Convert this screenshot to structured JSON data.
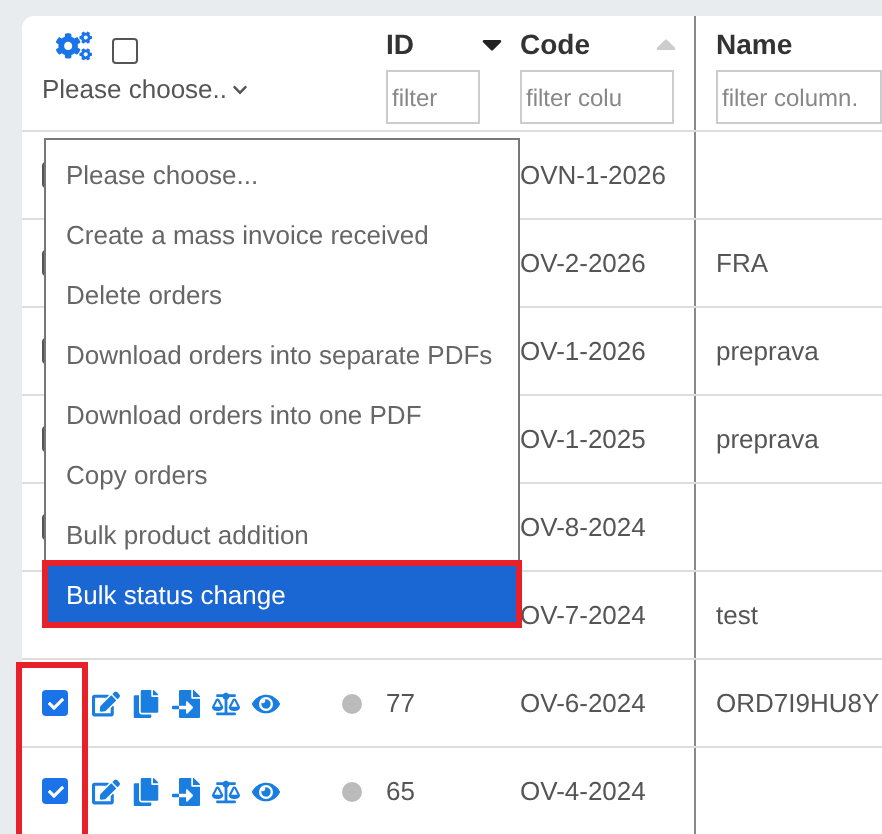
{
  "header": {
    "select_all": {
      "checked": false
    },
    "bulk_select": {
      "value": "Please choose.."
    },
    "columns": [
      {
        "label": "ID",
        "sort_active": true,
        "descending": true,
        "filter_placeholder": "filter"
      },
      {
        "label": "Code",
        "sort_active": false,
        "descending": false,
        "filter_placeholder": "filter colu"
      },
      {
        "label": "Name",
        "filter_placeholder": "filter column."
      }
    ]
  },
  "bulk_menu": {
    "items": [
      {
        "label": "Please choose...",
        "selected": false
      },
      {
        "label": "Create a mass invoice received",
        "selected": false
      },
      {
        "label": "Delete orders",
        "selected": false
      },
      {
        "label": "Download orders into separate PDFs",
        "selected": false
      },
      {
        "label": "Download orders into one PDF",
        "selected": false
      },
      {
        "label": "Copy orders",
        "selected": false
      },
      {
        "label": "Bulk product addition",
        "selected": false
      },
      {
        "label": "Bulk status change",
        "selected": true,
        "outlined": true
      }
    ]
  },
  "rows": [
    {
      "checked": false,
      "code": "OVN-1-2026"
    },
    {
      "checked": false,
      "code": "OV-2-2026",
      "name": "FRA"
    },
    {
      "checked": false,
      "code": "OV-1-2026",
      "name": "preprava"
    },
    {
      "checked": false,
      "code": "OV-1-2025",
      "name": "preprava"
    },
    {
      "checked": false,
      "code": "OV-8-2024"
    },
    {
      "code": "OV-7-2024",
      "name": "test"
    },
    {
      "checked": true,
      "outlined": true,
      "actions": true,
      "color": "#bbbbbb",
      "id": "77",
      "code": "OV-6-2024",
      "name": "ORD7I9HU8Y"
    },
    {
      "checked": true,
      "outlined": true,
      "actions": true,
      "color": "#bbbbbb",
      "id": "65",
      "code": "OV-4-2024"
    }
  ]
}
